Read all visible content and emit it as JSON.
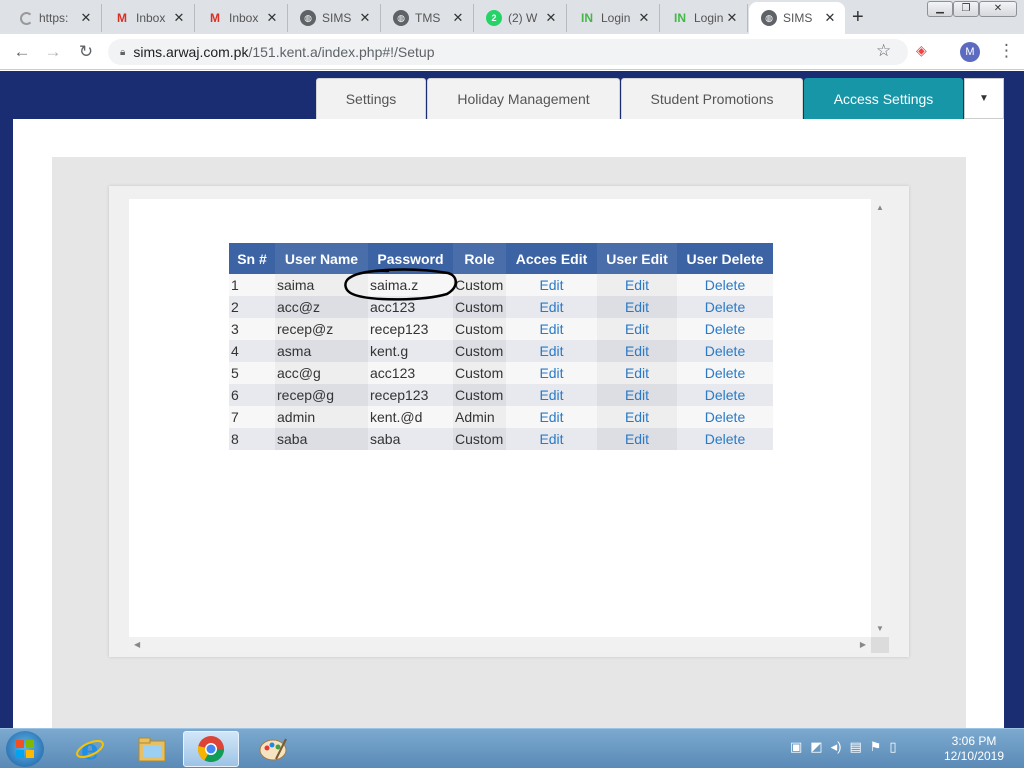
{
  "browser": {
    "tabs": [
      {
        "title": "https:",
        "icon": "loading-spinner-icon"
      },
      {
        "title": "Inbox",
        "icon": "gmail-icon"
      },
      {
        "title": "Inbox",
        "icon": "gmail-icon"
      },
      {
        "title": "SIMS",
        "icon": "globe-icon"
      },
      {
        "title": "TMS",
        "icon": "globe-icon"
      },
      {
        "title": "(2) W",
        "icon": "whatsapp-icon",
        "badge": "2"
      },
      {
        "title": "Login",
        "icon": "in-logo-icon"
      },
      {
        "title": "Login",
        "icon": "in-logo-icon"
      },
      {
        "title": "SIMS",
        "icon": "globe-icon",
        "active": true
      }
    ],
    "url_host": "sims.arwaj.com.pk",
    "url_path": "/151.kent.a/index.php#!/Setup",
    "profile_initial": "M"
  },
  "page_tabs": [
    {
      "label": "Settings"
    },
    {
      "label": "Holiday Management"
    },
    {
      "label": "Student Promotions"
    },
    {
      "label": "Access Settings",
      "active": true
    }
  ],
  "table": {
    "headers": [
      "Sn #",
      "User Name",
      "Password",
      "Role",
      "Acces Edit",
      "User Edit",
      "User Delete"
    ],
    "rows": [
      {
        "sn": "1",
        "user": "saima",
        "password": "saima.z",
        "role": "Custom",
        "access_edit": "Edit",
        "user_edit": "Edit",
        "user_delete": "Delete"
      },
      {
        "sn": "2",
        "user": "acc@z",
        "password": "acc123",
        "role": "Custom",
        "access_edit": "Edit",
        "user_edit": "Edit",
        "user_delete": "Delete"
      },
      {
        "sn": "3",
        "user": "recep@z",
        "password": "recep123",
        "role": "Custom",
        "access_edit": "Edit",
        "user_edit": "Edit",
        "user_delete": "Delete"
      },
      {
        "sn": "4",
        "user": "asma",
        "password": "kent.g",
        "role": "Custom",
        "access_edit": "Edit",
        "user_edit": "Edit",
        "user_delete": "Delete"
      },
      {
        "sn": "5",
        "user": "acc@g",
        "password": "acc123",
        "role": "Custom",
        "access_edit": "Edit",
        "user_edit": "Edit",
        "user_delete": "Delete"
      },
      {
        "sn": "6",
        "user": "recep@g",
        "password": "recep123",
        "role": "Custom",
        "access_edit": "Edit",
        "user_edit": "Edit",
        "user_delete": "Delete"
      },
      {
        "sn": "7",
        "user": "admin",
        "password": "kent.@d",
        "role": "Admin",
        "access_edit": "Edit",
        "user_edit": "Edit",
        "user_delete": "Delete"
      },
      {
        "sn": "8",
        "user": "saba",
        "password": "saba",
        "role": "Custom",
        "access_edit": "Edit",
        "user_edit": "Edit",
        "user_delete": "Delete"
      }
    ]
  },
  "taskbar": {
    "apps": [
      "internet-explorer-icon",
      "file-explorer-icon",
      "chrome-icon",
      "paint-icon"
    ],
    "time": "3:06 PM",
    "date": "12/10/2019"
  },
  "colors": {
    "page_background": "#1a2c72",
    "active_tab": "#1796a8",
    "table_header": "#3c63a4",
    "link": "#2a7ac6"
  }
}
